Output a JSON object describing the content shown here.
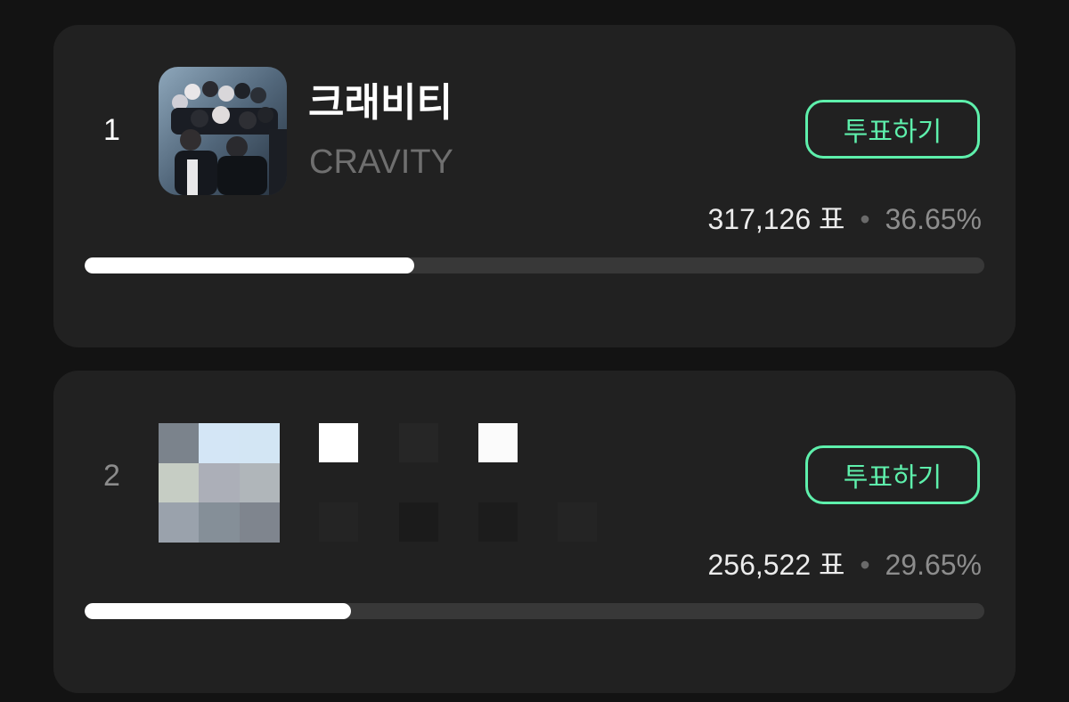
{
  "rankings": [
    {
      "rank": "1",
      "name": "크래비티",
      "subtitle": "CRAVITY",
      "vote_label": "투표하기",
      "votes": "317,126",
      "unit": "표",
      "separator": "•",
      "percent_text": "36.65%",
      "progress_fraction": 0.3665
    },
    {
      "rank": "2",
      "vote_label": "투표하기",
      "votes": "256,522",
      "unit": "표",
      "separator": "•",
      "percent_text": "29.65%",
      "progress_fraction": 0.2965
    }
  ],
  "colors": {
    "background": "#131313",
    "card": "#212121",
    "accent": "#5ef0ac",
    "progress_fill": "#ffffff",
    "progress_track": "#383838"
  }
}
